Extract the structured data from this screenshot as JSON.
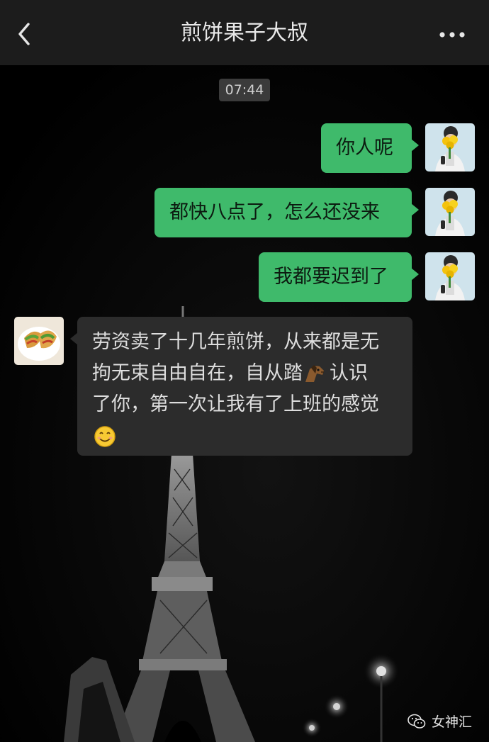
{
  "header": {
    "title": "煎饼果子大叔",
    "back_icon": "chevron-left-icon",
    "more_icon": "ellipsis-icon"
  },
  "chat": {
    "timestamp": "07:44",
    "messages": [
      {
        "direction": "out",
        "text": "你人呢"
      },
      {
        "direction": "out",
        "text": "都快八点了，怎么还没来"
      },
      {
        "direction": "out",
        "text": "我都要迟到了"
      },
      {
        "direction": "in",
        "line1": "劳资卖了十几年煎饼，从来都是无",
        "line2a": "拘无束自由自在，自从踏",
        "line2_emoji": "horse-face-emoji",
        "line2b": "认识",
        "line3": "了你，第一次让我有了上班的感觉",
        "line4_emoji": "smiling-face-emoji"
      }
    ]
  },
  "watermark": {
    "text": "女神汇",
    "icon": "wechat-official-account-icon"
  },
  "colors": {
    "header_bg": "#1c1c1c",
    "outgoing_bubble": "#3fba6b",
    "incoming_bubble": "#2c2c2c",
    "chat_bg": "#000000"
  }
}
